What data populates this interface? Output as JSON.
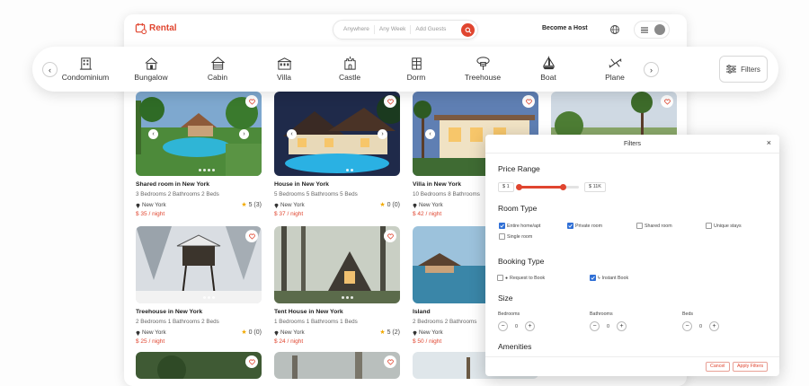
{
  "header": {
    "logo": "Rental",
    "search": {
      "where": "Anywhere",
      "when": "Any Week",
      "who": "Add Guests"
    },
    "become_host": "Become a Host"
  },
  "categories": [
    {
      "label": "Condominium",
      "icon": "building-icon"
    },
    {
      "label": "Bungalow",
      "icon": "bungalow-icon"
    },
    {
      "label": "Cabin",
      "icon": "cabin-icon"
    },
    {
      "label": "Villa",
      "icon": "villa-icon"
    },
    {
      "label": "Castle",
      "icon": "castle-icon"
    },
    {
      "label": "Dorm",
      "icon": "dorm-icon"
    },
    {
      "label": "Treehouse",
      "icon": "treehouse-icon"
    },
    {
      "label": "Boat",
      "icon": "boat-icon"
    },
    {
      "label": "Plane",
      "icon": "plane-icon"
    }
  ],
  "filters_button": "Filters",
  "listings": [
    {
      "title": "Shared room in New York",
      "meta": "3 Bedrooms  2 Bathrooms  2 Beds",
      "location": "New York",
      "rating": "5 (3)",
      "price": "$ 35 / night"
    },
    {
      "title": "House in New York",
      "meta": "5 Bedrooms  5 Bathrooms  5 Beds",
      "location": "New York",
      "rating": "0 (0)",
      "price": "$ 37 / night"
    },
    {
      "title": "Villa in New York",
      "meta": "10 Bedrooms  8 Bathrooms",
      "location": "New York",
      "rating": "",
      "price": "$ 42 / night"
    },
    {
      "title": "",
      "meta": "",
      "location": "",
      "rating": "",
      "price": ""
    },
    {
      "title": "Treehouse in New York",
      "meta": "2 Bedrooms  1 Bathrooms  2 Beds",
      "location": "New York",
      "rating": "0 (0)",
      "price": "$ 25 / night"
    },
    {
      "title": "Tent House in New York",
      "meta": "1 Bedrooms  1 Bathrooms  1 Beds",
      "location": "New York",
      "rating": "5 (2)",
      "price": "$ 24 / night"
    },
    {
      "title": "Island",
      "meta": "2 Bedrooms  2 Bathrooms",
      "location": "New York",
      "rating": "",
      "price": "$ 50 / night"
    }
  ],
  "filters_dialog": {
    "title": "Filters",
    "close": "×",
    "price_range": {
      "label": "Price Range",
      "min": "$ 1",
      "max": "$ 11K",
      "low_fraction": 0.05,
      "high_fraction": 0.75
    },
    "room_type": {
      "label": "Room Type",
      "options": [
        {
          "label": "Entire home/apt",
          "checked": true
        },
        {
          "label": "Private room",
          "checked": true
        },
        {
          "label": "Shared room",
          "checked": false
        },
        {
          "label": "Unique stays",
          "checked": false
        },
        {
          "label": "Single room",
          "checked": false
        }
      ]
    },
    "booking_type": {
      "label": "Booking Type",
      "options": [
        {
          "label": "Request to Book",
          "checked": false
        },
        {
          "label": "Instant Book",
          "checked": true
        }
      ]
    },
    "size": {
      "label": "Size",
      "fields": [
        {
          "label": "Bedrooms",
          "value": "0"
        },
        {
          "label": "Bathrooms",
          "value": "0"
        },
        {
          "label": "Beds",
          "value": "0"
        }
      ]
    },
    "amenities_label": "Amenities",
    "cancel": "Cancel",
    "apply": "Apply Filters"
  },
  "colors": {
    "accent": "#e0452f",
    "checkbox": "#2f6fd6"
  }
}
